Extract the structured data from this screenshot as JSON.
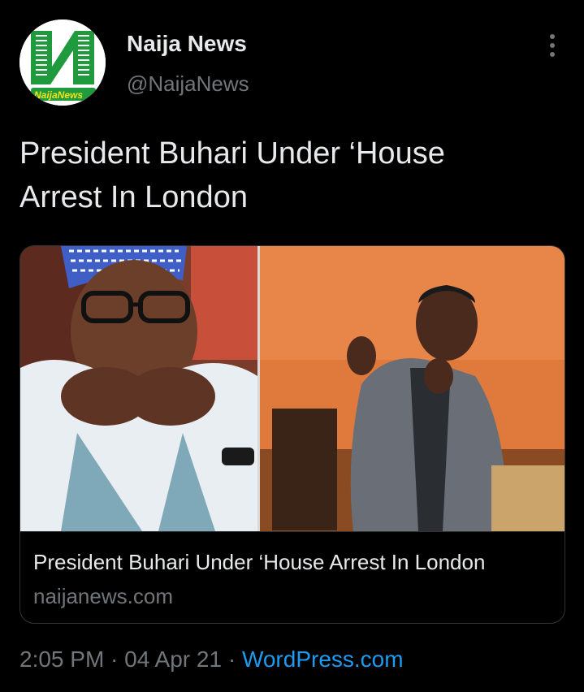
{
  "account": {
    "display_name": "Naija News",
    "handle": "@NaijaNews",
    "avatar_text": "NaijaNews",
    "avatar_icon": "naija-news-logo"
  },
  "tweet": {
    "line1": "President Buhari Under ‘House",
    "line2": "Arrest In London"
  },
  "card": {
    "title": "President Buhari Under ‘House Arrest In London",
    "domain": "naijanews.com"
  },
  "meta": {
    "time": "2:05 PM",
    "separator1": " · ",
    "date": "04 Apr 21",
    "separator2": " · ",
    "source": "WordPress.com"
  },
  "colors": {
    "background": "#000000",
    "primary_text": "#e7e9ea",
    "secondary_text": "#71767b",
    "link": "#1d9bf0",
    "border": "#2f3336",
    "logo_green": "#1f9a3c"
  }
}
